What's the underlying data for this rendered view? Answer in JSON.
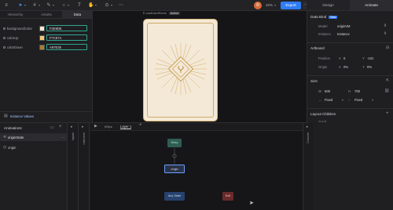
{
  "toolbar": {
    "zoom": "32%",
    "export_label": "Export",
    "avatar_letter": "R",
    "tools": [
      "pointer-tool",
      "frame-tool",
      "pen-tool",
      "shape-tool",
      "text-tool",
      "hand-tool",
      "component-tool"
    ]
  },
  "left_tabs": [
    "Hierarchy",
    "Assets",
    "Data"
  ],
  "left_active_tab": "Data",
  "properties": [
    {
      "name": "backgroundColor",
      "color": "#F3E9D6",
      "hex": "F2E9D6"
    },
    {
      "name": "colorUp",
      "color": "#F7C874",
      "hex": "F7C874"
    },
    {
      "name": "colorDown",
      "color": "#A97E35",
      "hex": "A97E35"
    }
  ],
  "instance_values_label": "Instance Values",
  "canvas": {
    "artboard_label": "E-card/cardHome",
    "artboard_badge": "Active"
  },
  "right_panel": {
    "tabs": [
      "Design",
      "Animate"
    ],
    "active_tab": "Animate",
    "data_bind": {
      "title": "Data Bind",
      "badge": "New",
      "model_label": "Model",
      "model_value": "originVM",
      "instance_label": "Instance",
      "instance_value": "Instance"
    },
    "artboard": {
      "title": "Artboard",
      "position_label": "Position",
      "x": "0",
      "y": "-101",
      "origin_label": "Origin",
      "ox": "0%",
      "oy": "0%"
    },
    "size": {
      "title": "Size",
      "w": "500",
      "h": "700",
      "w_mode": "Fixed",
      "h_mode": "Fixed"
    },
    "layout_children": {
      "title": "Layout Children",
      "scroll_label": "Scroll"
    }
  },
  "animations": {
    "title": "Animations",
    "items": [
      "originState",
      "origin"
    ],
    "selected": "originState"
  },
  "state_machine": {
    "inputs_label": "Inputs",
    "listeners_label": "Listeners",
    "layer_tab": "Layer 1",
    "fps": "60fps",
    "console_label": "Console",
    "nodes": {
      "entry": "Entry",
      "state": "origin",
      "any": "Any State",
      "exit": "Exit"
    }
  }
}
